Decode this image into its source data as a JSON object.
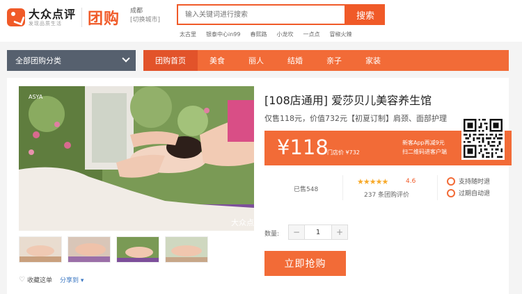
{
  "header": {
    "logo_name": "大众点评",
    "logo_sub": "发现品质生活",
    "section": "团购",
    "city": "成都",
    "city_switch": "[切换城市]",
    "search_placeholder": "输入关键词进行搜索",
    "search_button": "搜索",
    "hot_words": [
      "太古里",
      "银泰中心in99",
      "春熙路",
      "小龙坎",
      "一点点",
      "冒椒火辣"
    ]
  },
  "nav": {
    "category_label": "全部团购分类",
    "tabs": [
      "团购首页",
      "美食",
      "丽人",
      "结婚",
      "亲子",
      "家装"
    ]
  },
  "deal": {
    "title": "[108店通用] 爱莎贝儿美容养生馆",
    "description": "仅售118元，价值732元【初夏订制】肩颈、面部护理",
    "price": "¥118",
    "store_price": "门店价 ¥732",
    "app_promo_line1": "新客App再减9元",
    "app_promo_line2": "扫二维码进客户端",
    "sold": "已售548",
    "stars": "★★★★★",
    "rating": "4.6",
    "reviews": "237 条团购评价",
    "guarantee_1": "支持随时退",
    "guarantee_2": "过期自动退",
    "qty_label": "数量:",
    "qty_minus": "−",
    "qty_value": "1",
    "qty_plus": "+",
    "buy_button": "立即抢购",
    "photo_brand": "ASYA",
    "photo_watermark": "大众点评"
  },
  "actions": {
    "favorite": "收藏这单",
    "share": "分享到 ▾"
  },
  "colors": {
    "accent": "#f26b37",
    "brand": "#f05a28",
    "nav_dark": "#56606e"
  }
}
